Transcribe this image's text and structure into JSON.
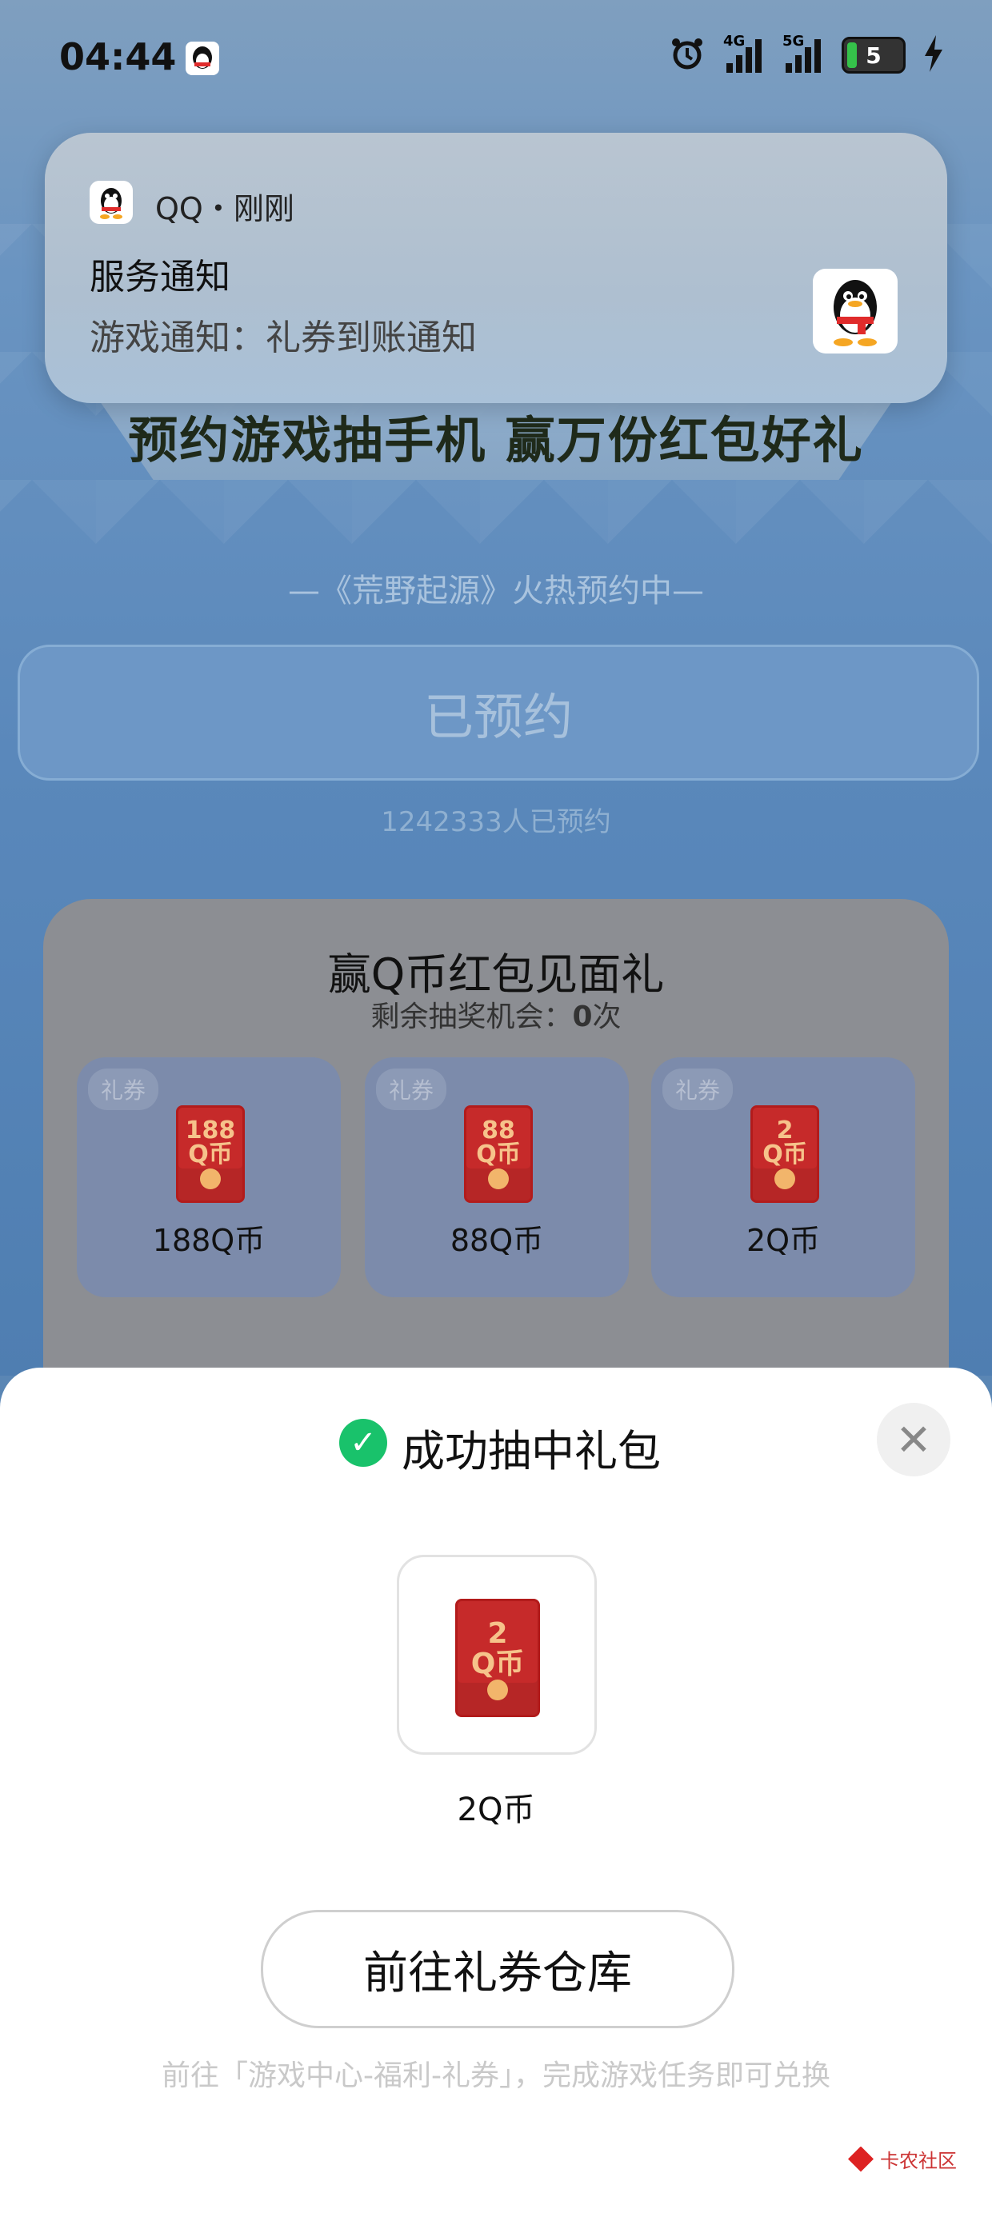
{
  "status": {
    "time": "04:44",
    "net1": "4G",
    "net2": "5G",
    "battery": "5"
  },
  "notification": {
    "app": "QQ・刚刚",
    "title": "服务通知",
    "body": "游戏通知：礼券到账通知"
  },
  "event": {
    "banner": "预约游戏抽手机 赢万份红包好礼",
    "subtitle": "—《荒野起源》火热预约中—",
    "reserve_button": "已预约",
    "reserve_count": "1242333人已预约"
  },
  "lottery": {
    "title": "赢Q币红包见面礼",
    "remaining_prefix": "剩余抽奖机会：",
    "remaining_value": "0",
    "remaining_suffix": "次",
    "prizes": [
      {
        "tag": "礼券",
        "amount": "188",
        "unit": "Q币",
        "label": "188Q币"
      },
      {
        "tag": "礼券",
        "amount": "88",
        "unit": "Q币",
        "label": "88Q币"
      },
      {
        "tag": "礼券",
        "amount": "2",
        "unit": "Q币",
        "label": "2Q币"
      }
    ]
  },
  "result_sheet": {
    "title": "成功抽中礼包",
    "reward_amount": "2",
    "reward_unit": "Q币",
    "reward_label": "2Q币",
    "button": "前往礼券仓库",
    "hint": "前往「游戏中心-福利-礼券」，完成游戏任务即可兑换"
  },
  "watermark": {
    "text": "卡农社区"
  },
  "colors": {
    "success_green": "#19c26b",
    "redpack_red": "#c62a2a",
    "page_blue": "#5a88bb"
  }
}
